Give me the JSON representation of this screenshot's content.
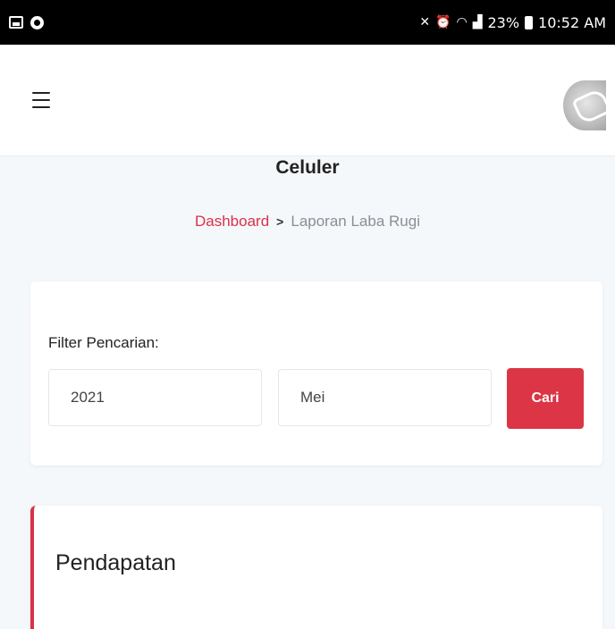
{
  "status_bar": {
    "time": "10:52 AM",
    "battery": "23%",
    "icons": [
      "image-icon",
      "circle-dot-icon",
      "mute-icon",
      "alarm-icon",
      "wifi-icon",
      "signal-icon",
      "battery-icon"
    ]
  },
  "header": {
    "menu_icon": "hamburger-menu-icon",
    "avatar_icon": "user-avatar-icon"
  },
  "page": {
    "title": "Celuler"
  },
  "breadcrumb": {
    "link": "Dashboard",
    "separator": ">",
    "current": "Laporan Laba Rugi"
  },
  "filter": {
    "label": "Filter Pencarian:",
    "year_value": "2021",
    "month_value": "Mei",
    "button_label": "Cari"
  },
  "income_section": {
    "title": "Pendapatan"
  },
  "colors": {
    "accent": "#dc3545",
    "background": "#f5f8fa",
    "card": "#ffffff"
  }
}
